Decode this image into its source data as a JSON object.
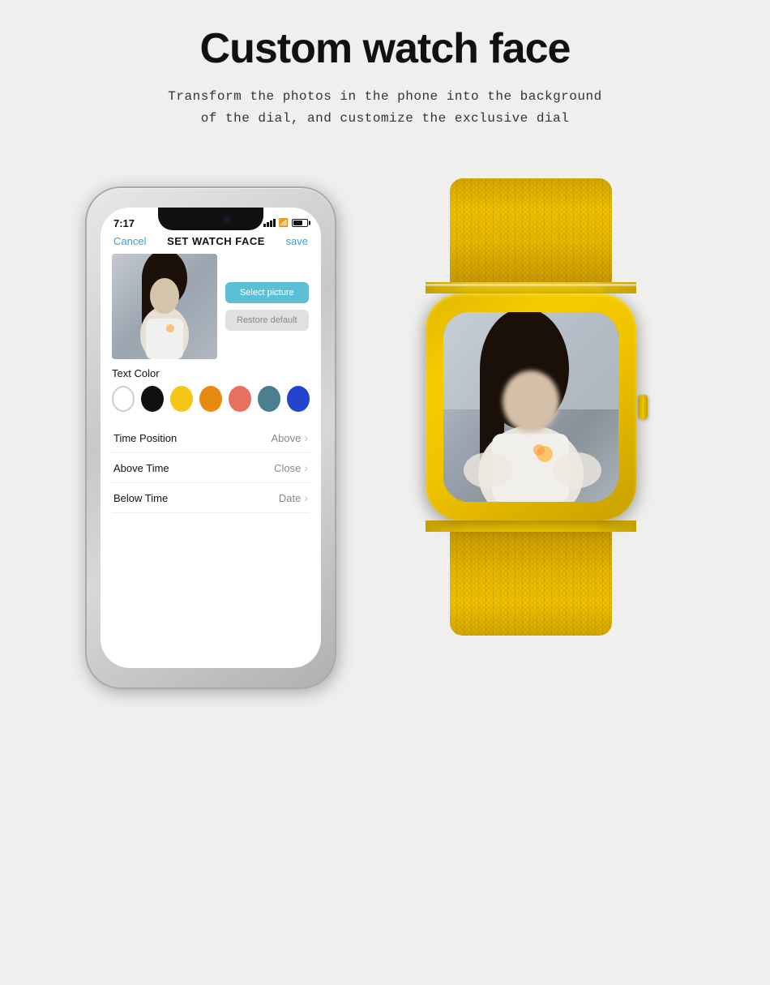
{
  "page": {
    "title": "Custom watch face",
    "subtitle_line1": "Transform the photos in the phone into the background",
    "subtitle_line2": "of the dial, and customize the exclusive dial"
  },
  "phone": {
    "status_time": "7:17",
    "header": {
      "cancel": "Cancel",
      "title": "SET WATCH FACE",
      "save": "save"
    },
    "buttons": {
      "select_picture": "Select picture",
      "restore_default": "Restore default"
    },
    "text_color_label": "Text Color",
    "colors": [
      "white",
      "black",
      "yellow",
      "orange",
      "salmon",
      "teal",
      "blue"
    ],
    "settings": [
      {
        "label": "Time Position",
        "value": "Above"
      },
      {
        "label": "Above Time",
        "value": "Close"
      },
      {
        "label": "Below Time",
        "value": "Date"
      }
    ]
  },
  "watch": {
    "band_color": "#e8b800"
  }
}
